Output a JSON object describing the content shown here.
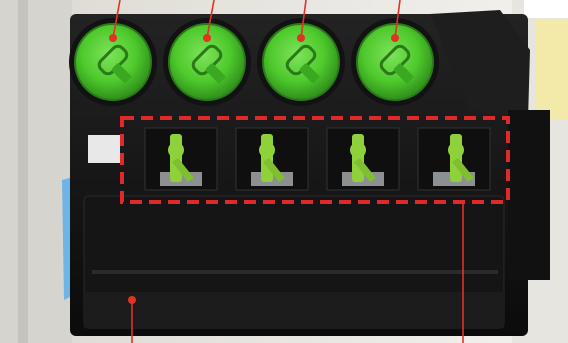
{
  "image": {
    "subject": "printer-interior",
    "colors": {
      "frame": "#eceae6",
      "body": "#161616",
      "toner": "#4ec92c",
      "lever": "#8fd13a",
      "highlight": "#e02a2a",
      "callout": "#e03322"
    },
    "toner_cartridges": [
      {
        "icon": "toner-cartridge-icon"
      },
      {
        "icon": "toner-cartridge-icon"
      },
      {
        "icon": "toner-cartridge-icon"
      },
      {
        "icon": "toner-cartridge-icon"
      }
    ],
    "levers": [
      {
        "icon": "lever-icon"
      },
      {
        "icon": "lever-icon"
      },
      {
        "icon": "lever-icon"
      },
      {
        "icon": "lever-icon"
      }
    ]
  }
}
